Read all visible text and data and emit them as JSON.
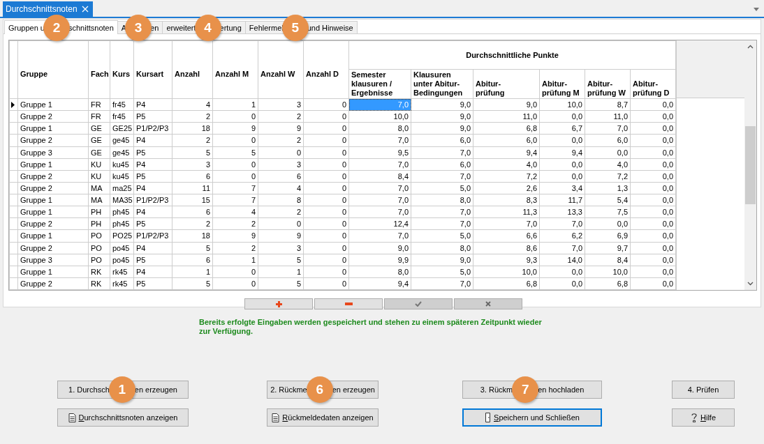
{
  "document_tab": {
    "title": "Durchschnittsnoten",
    "selected": true
  },
  "tabs": [
    {
      "text_before": "Gruppen u",
      "callout": "2",
      "text_after": "schnittsnoten",
      "selected": true
    },
    {
      "text_before": "A",
      "callout": "3",
      "text_after": "en",
      "selected": false
    },
    {
      "text_before": "erweitert",
      "callout": "4",
      "text_after": "ertung",
      "selected": false
    },
    {
      "text_before": "Fehlermel",
      "callout": "5",
      "text_after": "und Hinweise",
      "selected": false
    }
  ],
  "table": {
    "columns": [
      "Gruppe",
      "Fach",
      "Kurs",
      "Kursart",
      "Anzahl",
      "Anzahl M",
      "Anzahl W",
      "Anzahl D"
    ],
    "group_header": "Durchschnittliche Punkte",
    "sub_columns": [
      "Semester\nklausuren /\nErgebnisse",
      "Klausuren\nunter Abitur-\nBedingungen",
      "Abitur-\nprüfung",
      "Abitur-\nprüfung M",
      "Abitur-\nprüfung W",
      "Abitur-\nprüfung D"
    ],
    "rows": [
      {
        "selected": true,
        "cells": [
          "Gruppe 1",
          "FR",
          "fr45",
          "P4",
          "4",
          "1",
          "3",
          "0",
          "7,0",
          "9,0",
          "9,0",
          "10,0",
          "8,7",
          "0,0"
        ]
      },
      {
        "selected": false,
        "cells": [
          "Gruppe 2",
          "FR",
          "fr45",
          "P5",
          "2",
          "0",
          "2",
          "0",
          "10,0",
          "9,0",
          "11,0",
          "0,0",
          "11,0",
          "0,0"
        ]
      },
      {
        "selected": false,
        "cells": [
          "Gruppe 1",
          "GE",
          "GE25",
          "P1/P2/P3",
          "18",
          "9",
          "9",
          "0",
          "8,0",
          "9,0",
          "6,8",
          "6,7",
          "7,0",
          "0,0"
        ]
      },
      {
        "selected": false,
        "cells": [
          "Gruppe 2",
          "GE",
          "ge45",
          "P4",
          "2",
          "0",
          "2",
          "0",
          "7,0",
          "6,0",
          "6,0",
          "0,0",
          "6,0",
          "0,0"
        ]
      },
      {
        "selected": false,
        "cells": [
          "Gruppe 3",
          "GE",
          "ge45",
          "P5",
          "5",
          "5",
          "0",
          "0",
          "9,5",
          "7,0",
          "9,4",
          "9,4",
          "0,0",
          "0,0"
        ]
      },
      {
        "selected": false,
        "cells": [
          "Gruppe 1",
          "KU",
          "ku45",
          "P4",
          "3",
          "0",
          "3",
          "0",
          "7,0",
          "6,0",
          "4,0",
          "0,0",
          "4,0",
          "0,0"
        ]
      },
      {
        "selected": false,
        "cells": [
          "Gruppe 2",
          "KU",
          "ku45",
          "P5",
          "6",
          "0",
          "6",
          "0",
          "8,4",
          "7,0",
          "7,2",
          "0,0",
          "7,2",
          "0,0"
        ]
      },
      {
        "selected": false,
        "cells": [
          "Gruppe 2",
          "MA",
          "ma25",
          "P4",
          "11",
          "7",
          "4",
          "0",
          "7,0",
          "5,0",
          "2,6",
          "3,4",
          "1,3",
          "0,0"
        ]
      },
      {
        "selected": false,
        "cells": [
          "Gruppe 1",
          "MA",
          "MA35",
          "P1/P2/P3",
          "15",
          "7",
          "8",
          "0",
          "7,0",
          "8,0",
          "8,3",
          "11,7",
          "5,4",
          "0,0"
        ]
      },
      {
        "selected": false,
        "cells": [
          "Gruppe 1",
          "PH",
          "ph45",
          "P4",
          "6",
          "4",
          "2",
          "0",
          "7,0",
          "7,0",
          "11,3",
          "13,3",
          "7,5",
          "0,0"
        ]
      },
      {
        "selected": false,
        "cells": [
          "Gruppe 2",
          "PH",
          "ph45",
          "P5",
          "2",
          "2",
          "0",
          "0",
          "12,4",
          "7,0",
          "7,0",
          "7,0",
          "0,0",
          "0,0"
        ]
      },
      {
        "selected": false,
        "cells": [
          "Gruppe 1",
          "PO",
          "PO25",
          "P1/P2/P3",
          "18",
          "9",
          "9",
          "0",
          "7,0",
          "5,0",
          "6,6",
          "6,2",
          "6,9",
          "0,0"
        ]
      },
      {
        "selected": false,
        "cells": [
          "Gruppe 2",
          "PO",
          "po45",
          "P4",
          "5",
          "2",
          "3",
          "0",
          "9,0",
          "8,0",
          "8,6",
          "7,0",
          "9,7",
          "0,0"
        ]
      },
      {
        "selected": false,
        "cells": [
          "Gruppe 3",
          "PO",
          "po45",
          "P5",
          "6",
          "1",
          "5",
          "0",
          "9,9",
          "9,0",
          "9,3",
          "14,0",
          "8,4",
          "0,0"
        ]
      },
      {
        "selected": false,
        "cells": [
          "Gruppe 1",
          "RK",
          "rk45",
          "P4",
          "1",
          "0",
          "1",
          "0",
          "8,0",
          "5,0",
          "10,0",
          "0,0",
          "10,0",
          "0,0"
        ]
      },
      {
        "selected": false,
        "cells": [
          "Gruppe 2",
          "RK",
          "rk45",
          "P5",
          "5",
          "0",
          "5",
          "0",
          "9,4",
          "7,0",
          "6,8",
          "0,0",
          "6,8",
          "0,0"
        ]
      }
    ]
  },
  "row_buttons": [
    {
      "kind": "add",
      "disabled": false
    },
    {
      "kind": "remove",
      "disabled": false
    },
    {
      "kind": "confirm",
      "disabled": true
    },
    {
      "kind": "cancel",
      "disabled": true
    }
  ],
  "notice": "Bereits erfolgte Eingaben werden gespeichert und stehen zu einem späteren Zeitpunkt wieder zur Verfügung.",
  "actions": [
    [
      {
        "kind": "plain",
        "text_before": "1. Durchsch",
        "callout": "1",
        "text_after": "en erzeugen",
        "focused": false
      },
      {
        "kind": "plain",
        "text_before": "2. Rückme",
        "callout": "6",
        "text_after": "en erzeugen",
        "focused": false
      },
      {
        "kind": "plain",
        "text_before": "3. Rückm",
        "callout": "7",
        "text_after": "en hochladen",
        "focused": false
      },
      {
        "kind": "plain",
        "text_before": "4. Prüfen",
        "focused": false
      }
    ],
    [
      {
        "kind": "report",
        "text_before": "Durchschnittsnoten anzeigen",
        "focused": false
      },
      {
        "kind": "report",
        "text_before": "Rückmeldedaten anzeigen",
        "focused": false
      },
      {
        "kind": "exit",
        "text_before": "Speichern und Schließen",
        "focused": true
      },
      {
        "kind": "help",
        "text_before": "Hilfe",
        "focused": false
      }
    ]
  ]
}
